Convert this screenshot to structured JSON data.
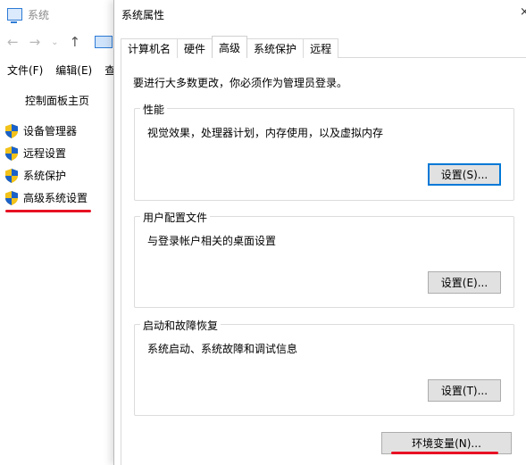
{
  "background_window": {
    "title": "系统",
    "menu": [
      "文件(F)",
      "编辑(E)",
      "查"
    ],
    "control_panel_home": "控制面板主页",
    "side_items": [
      {
        "label": "设备管理器",
        "icon": "uac-shield-icon"
      },
      {
        "label": "远程设置",
        "icon": "uac-shield-icon"
      },
      {
        "label": "系统保护",
        "icon": "uac-shield-icon"
      },
      {
        "label": "高级系统设置",
        "icon": "uac-shield-icon"
      }
    ],
    "highlight_color": "#e81123"
  },
  "dialog": {
    "title": "系统属性",
    "close_glyph": "×",
    "tabs": [
      {
        "label": "计算机名",
        "active": false
      },
      {
        "label": "硬件",
        "active": false
      },
      {
        "label": "高级",
        "active": true
      },
      {
        "label": "系统保护",
        "active": false
      },
      {
        "label": "远程",
        "active": false
      }
    ],
    "intro": "要进行大多数更改，你必须作为管理员登录。",
    "groups": {
      "performance": {
        "label": "性能",
        "description": "视觉效果，处理器计划，内存使用，以及虚拟内存",
        "button": "设置(S)..."
      },
      "user_profiles": {
        "label": "用户配置文件",
        "description": "与登录帐户相关的桌面设置",
        "button": "设置(E)..."
      },
      "startup_recovery": {
        "label": "启动和故障恢复",
        "description": "系统启动、系统故障和调试信息",
        "button": "设置(T)..."
      }
    },
    "env_button": "环境变量(N)...",
    "accent_color": "#0078d7"
  }
}
